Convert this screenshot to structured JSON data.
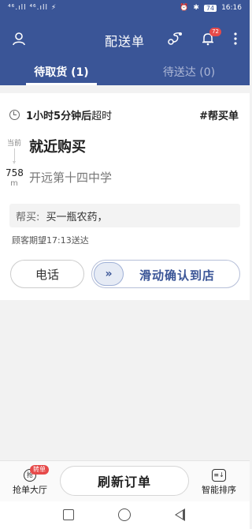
{
  "status_bar": {
    "signal": "⁴⁶.ıll ⁴⁶.ıll ⚡",
    "battery": "74",
    "time": "16:16"
  },
  "header": {
    "title": "配送单",
    "notification_count": "72"
  },
  "tabs": [
    {
      "label": "待取货 (1)",
      "active": true
    },
    {
      "label": "待送达 (0)",
      "active": false
    }
  ],
  "order": {
    "timer": "1小时5分钟后",
    "timer_suffix": "超时",
    "type_tag": "#帮买单",
    "current_label": "当前",
    "pickup": "就近购买",
    "distance_value": "758",
    "distance_unit": "m",
    "destination": "开远第十四中学",
    "note_label": "帮买:",
    "note_text": "买一瓶农药，",
    "expected": "顾客期望17:13送达",
    "call_label": "电话",
    "slide_label": "滑动确认到店"
  },
  "bottom_bar": {
    "grab_label": "抢单大厅",
    "grab_badge": "转单",
    "refresh_label": "刷新订单",
    "sort_label": "智能排序"
  },
  "colors": {
    "primary": "#3a5597",
    "badge": "#e64a4a"
  }
}
